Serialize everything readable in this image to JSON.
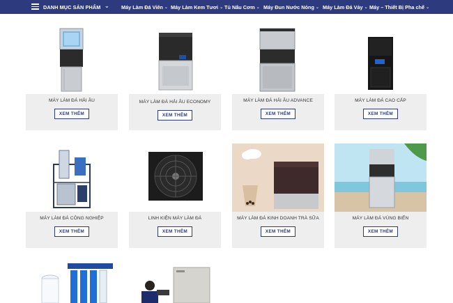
{
  "nav": {
    "category_label": "DANH MỤC SẢN PHẨM",
    "items": [
      {
        "label": "Máy Làm Đá Viên"
      },
      {
        "label": "Máy Làm Kem Tươi"
      },
      {
        "label": "Tủ Nấu Cơm"
      },
      {
        "label": "Máy Đun Nước Nóng"
      },
      {
        "label": "Máy Làm Đá Vảy"
      },
      {
        "label": "Máy – Thiết Bị Pha chế"
      }
    ]
  },
  "products": [
    {
      "title": "MÁY LÀM ĐÁ HẢI ÂU",
      "button": "XEM THÊM"
    },
    {
      "title": "MÁY LÀM ĐÁ HẢI ÂU ECONOMY",
      "button": "XEM THÊM"
    },
    {
      "title": "MÁY LÀM ĐÁ HẢI ÂU ADVANCE",
      "button": "XEM THÊM"
    },
    {
      "title": "MÁY LÀM ĐÁ CAO CẤP",
      "button": "XEM THÊM"
    },
    {
      "title": "MÁY LÀM ĐÁ CÔNG NGHIỆP",
      "button": "XEM THÊM"
    },
    {
      "title": "LINH KIỆN MÁY LÀM ĐÁ",
      "button": "XEM THÊM"
    },
    {
      "title": "MÁY LÀM ĐÁ KINH DOANH TRÀ SỮA",
      "button": "XEM THÊM"
    },
    {
      "title": "MÁY LÀM ĐÁ VÙNG BIỂN",
      "button": "XEM THÊM"
    }
  ],
  "colors": {
    "nav_bg": "#2e3a7e",
    "card_bg": "#eeeeee",
    "button_border": "#2e3a7e"
  }
}
